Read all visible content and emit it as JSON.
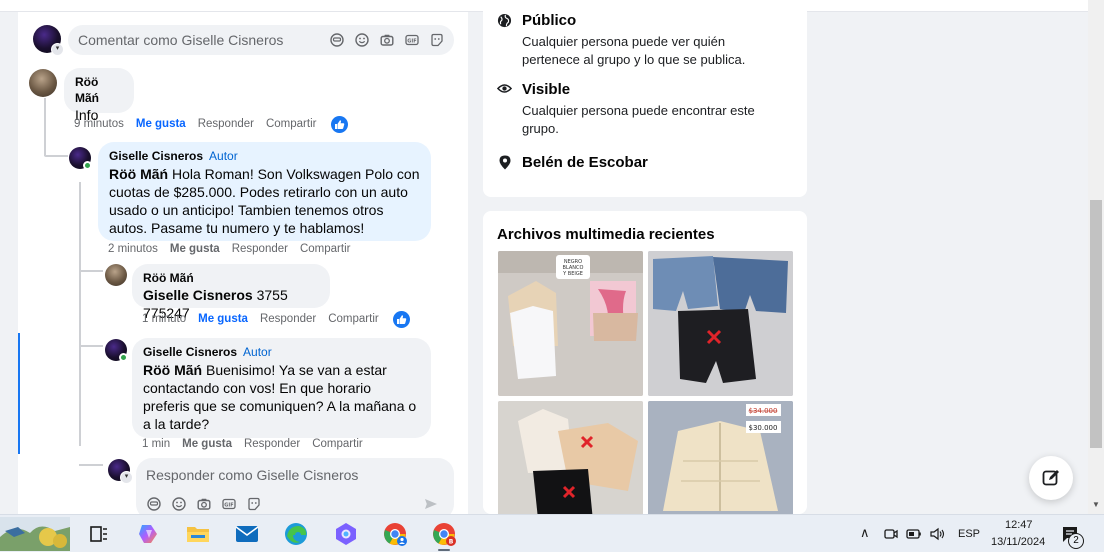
{
  "comment_input": {
    "placeholder": "Comentar como Giselle Cisneros"
  },
  "comments": [
    {
      "author": "Röö Mãń",
      "text": "Info",
      "time": "9 minutos",
      "like": "Me gusta",
      "reply": "Responder",
      "share": "Compartir"
    },
    {
      "author": "Giselle Cisneros",
      "badge": "Autor",
      "mention": "Röö Mãń",
      "text": " Hola Roman! Son Volkswagen Polo con cuotas de $285.000. Podes retirarlo con un auto usado o un anticipo! Tambien tenemos otros autos. Pasame tu numero y te hablamos!",
      "time": "2 minutos",
      "like": "Me gusta",
      "reply": "Responder",
      "share": "Compartir"
    },
    {
      "author": "Röö Mãń",
      "mention": "Giselle Cisneros",
      "text": " 3755 775247",
      "time": "1 minuto",
      "like": "Me gusta",
      "reply": "Responder",
      "share": "Compartir"
    },
    {
      "author": "Giselle Cisneros",
      "badge": "Autor",
      "mention": "Röö Mãń",
      "text": " Buenisimo! Ya se van a estar contactando con vos! En que horario preferis que se comuniquen? A la mañana o a la tarde?",
      "time": "1 min",
      "like": "Me gusta",
      "reply": "Responder",
      "share": "Compartir"
    }
  ],
  "reply_input": {
    "placeholder": "Responder como Giselle Cisneros"
  },
  "group_info": {
    "public_title": "Público",
    "public_desc": "Cualquier persona puede ver quién pertenece al grupo y lo que se publica.",
    "visible_title": "Visible",
    "visible_desc": "Cualquier persona puede encontrar este grupo.",
    "location": "Belén de Escobar"
  },
  "media": {
    "title": "Archivos multimedia recientes",
    "photo1_tag": "NEGRO BLANCO Y BEIGE",
    "photo4_old_price": "$34.000",
    "photo4_price": "$30.000"
  },
  "taskbar": {
    "language": "ESP",
    "time": "12:47",
    "date": "13/11/2024",
    "notification_count": "2"
  },
  "colors": {
    "accent": "#0866ff",
    "author_badge": "#0064d1",
    "online": "#31a24c"
  }
}
